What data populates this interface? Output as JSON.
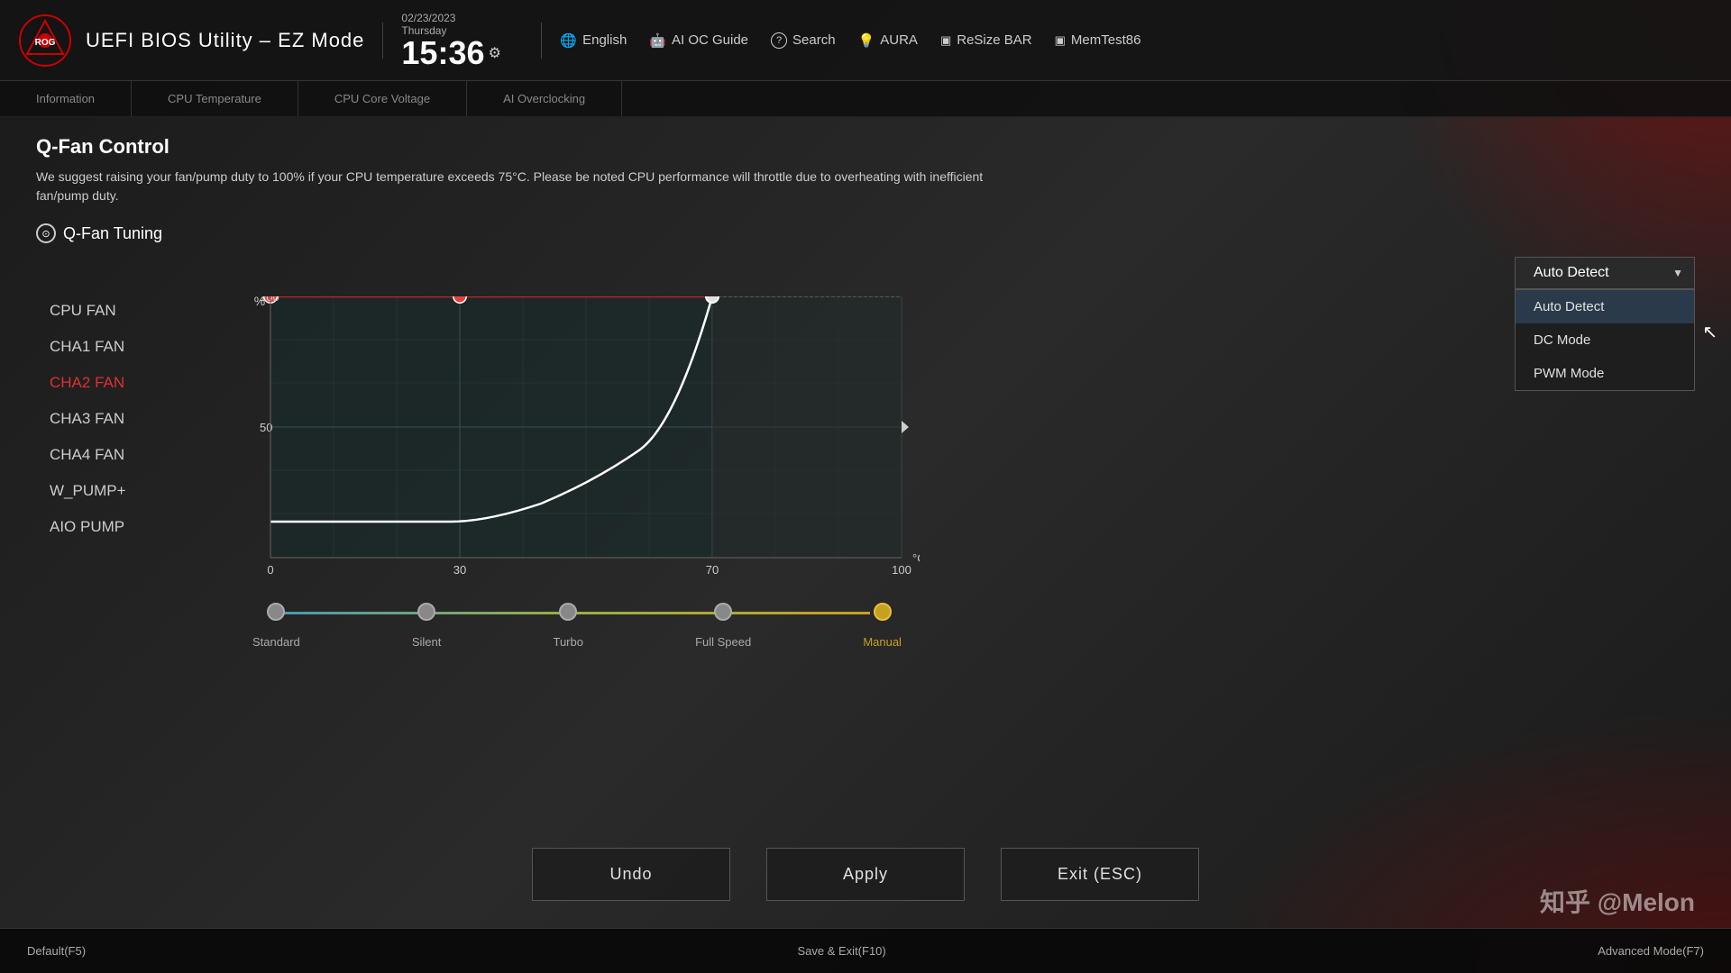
{
  "app": {
    "title": "UEFI BIOS Utility – EZ Mode",
    "logo_text": "ROG"
  },
  "topbar": {
    "datetime": {
      "date": "02/23/2023",
      "day": "Thursday",
      "time": "15:36",
      "settings_icon": "⚙"
    },
    "nav_items": [
      {
        "id": "english",
        "icon": "🌐",
        "label": "English"
      },
      {
        "id": "ai_oc_guide",
        "icon": "🤖",
        "label": "AI OC Guide"
      },
      {
        "id": "search",
        "icon": "?",
        "label": "Search"
      },
      {
        "id": "aura",
        "icon": "💡",
        "label": "AURA"
      },
      {
        "id": "resizetbar",
        "icon": "▣",
        "label": "ReSize BAR"
      },
      {
        "id": "memtest",
        "icon": "▣",
        "label": "MemTest86"
      }
    ]
  },
  "nav_tabs": [
    {
      "id": "information",
      "label": "Information"
    },
    {
      "id": "cpu_temperature",
      "label": "CPU Temperature"
    },
    {
      "id": "cpu_core_voltage",
      "label": "CPU Core Voltage"
    },
    {
      "id": "ai_overclocking",
      "label": "AI Overclocking"
    }
  ],
  "qfan": {
    "title": "Q-Fan Control",
    "description": "We suggest raising your fan/pump duty to 100% if your CPU temperature exceeds 75°C. Please be noted CPU performance will throttle due to overheating with inefficient fan/pump duty.",
    "tuning_label": "Q-Fan Tuning",
    "fan_list": [
      {
        "id": "cpu_fan",
        "label": "CPU FAN",
        "active": false
      },
      {
        "id": "cha1_fan",
        "label": "CHA1 FAN",
        "active": false
      },
      {
        "id": "cha2_fan",
        "label": "CHA2 FAN",
        "active": true
      },
      {
        "id": "cha3_fan",
        "label": "CHA3 FAN",
        "active": false
      },
      {
        "id": "cha4_fan",
        "label": "CHA4 FAN",
        "active": false
      },
      {
        "id": "w_pump",
        "label": "W_PUMP+",
        "active": false
      },
      {
        "id": "aio_pump",
        "label": "AIO PUMP",
        "active": false
      }
    ],
    "dropdown": {
      "current_value": "Auto Detect",
      "options": [
        {
          "id": "auto_detect",
          "label": "Auto Detect",
          "highlighted": true
        },
        {
          "id": "dc_mode",
          "label": "DC Mode",
          "highlighted": false
        },
        {
          "id": "pwm_mode",
          "label": "PWM Mode",
          "highlighted": false
        }
      ]
    },
    "chart": {
      "x_axis_label": "°C",
      "y_axis_label": "%",
      "x_ticks": [
        "0",
        "30",
        "70",
        "100"
      ],
      "y_ticks": [
        "100",
        "50"
      ],
      "x_min": 0,
      "x_max": 100,
      "y_min": 0,
      "y_max": 100
    },
    "speed_presets": [
      {
        "id": "standard",
        "label": "Standard",
        "active": false
      },
      {
        "id": "silent",
        "label": "Silent",
        "active": false
      },
      {
        "id": "turbo",
        "label": "Turbo",
        "active": false
      },
      {
        "id": "full_speed",
        "label": "Full Speed",
        "active": false
      },
      {
        "id": "manual",
        "label": "Manual",
        "active": true
      }
    ]
  },
  "buttons": {
    "undo": "Undo",
    "apply": "Apply",
    "exit": "Exit (ESC)"
  },
  "footer": {
    "default": "Default(F5)",
    "save_exit": "Save & Exit(F10)",
    "advanced_mode": "Advanced Mode(F7)"
  },
  "watermark": "知乎 @Melon"
}
